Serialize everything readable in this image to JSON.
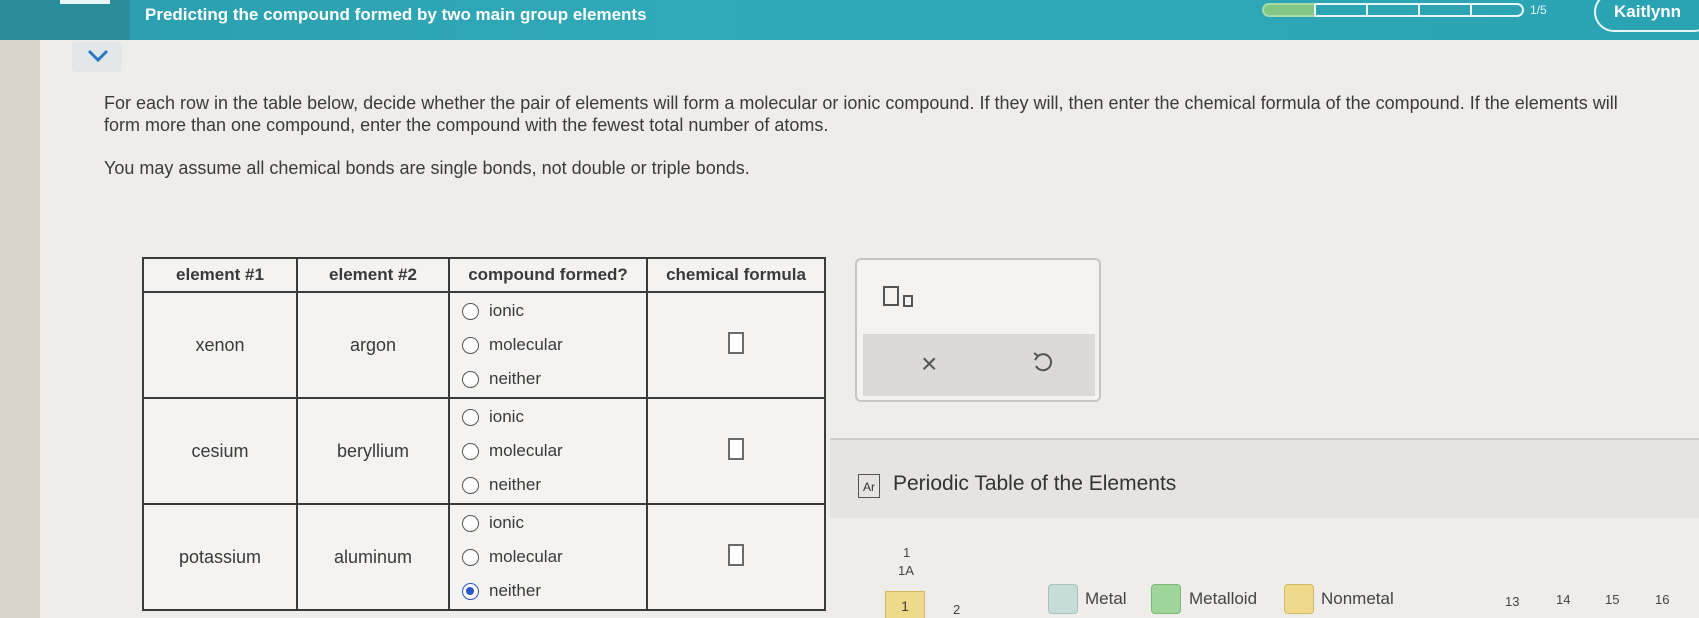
{
  "header": {
    "title": "Predicting the compound formed by two main group elements",
    "progress": {
      "completed": 1,
      "total": 5,
      "label": "1/5"
    },
    "user_name": "Kaitlynn"
  },
  "instructions": "For each row in the table below, decide whether the pair of elements will form a molecular or ionic compound. If they will, then enter the chemical formula of the compound. If the elements will form more than one compound, enter the compound with the fewest total number of atoms.",
  "note": "You may assume all chemical bonds are single bonds, not double or triple bonds.",
  "table": {
    "headers": [
      "element #1",
      "element #2",
      "compound formed?",
      "chemical formula"
    ],
    "options": [
      "ionic",
      "molecular",
      "neither"
    ],
    "rows": [
      {
        "element1": "xenon",
        "element2": "argon",
        "selected": null,
        "formula": ""
      },
      {
        "element1": "cesium",
        "element2": "beryllium",
        "selected": null,
        "formula": ""
      },
      {
        "element1": "potassium",
        "element2": "aluminum",
        "selected": "neither",
        "formula": ""
      }
    ]
  },
  "tools": {
    "clear_symbol": "×",
    "undo_symbol": "undo-icon"
  },
  "periodic_table": {
    "icon_text": "Ar",
    "title": "Periodic Table of the Elements",
    "group_1_number": "1",
    "group_1_label": "1A",
    "period_1_label": "1",
    "group_2_label": "2",
    "legend": [
      {
        "label": "Metal",
        "color": "#c6ddd9"
      },
      {
        "label": "Metalloid",
        "color": "#9fd49a"
      },
      {
        "label": "Nonmetal",
        "color": "#efd98a"
      }
    ],
    "group_numbers": [
      "13",
      "14",
      "15",
      "16"
    ]
  },
  "colors": {
    "header_bg": "#31a9b8",
    "selected_radio": "#2a55c4",
    "progress_filled": "#83c785"
  }
}
